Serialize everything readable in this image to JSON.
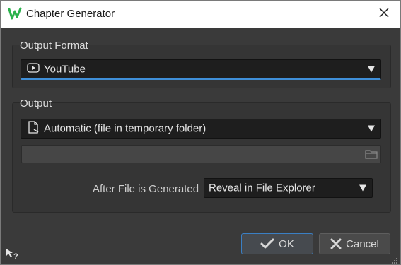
{
  "window": {
    "title": "Chapter Generator"
  },
  "output_format": {
    "group_title": "Output Format",
    "selected": "YouTube",
    "icon": "play-icon"
  },
  "output": {
    "group_title": "Output",
    "mode_selected": "Automatic (file in temporary folder)",
    "mode_icon": "file-icon",
    "path_value": "",
    "folder_icon": "folder-icon",
    "after_label": "After File is Generated",
    "after_selected": "Reveal in File Explorer"
  },
  "buttons": {
    "ok_label": "OK",
    "cancel_label": "Cancel"
  },
  "colors": {
    "accent": "#3f8fd8",
    "background": "#3a3a3a",
    "field": "#1e1e1e"
  }
}
